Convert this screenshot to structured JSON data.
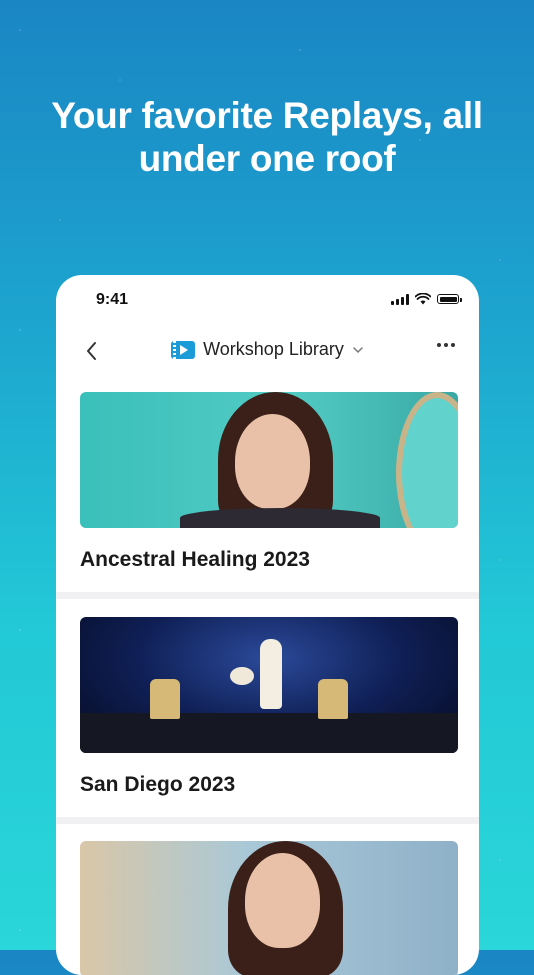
{
  "headline": "Your favorite Replays, all under one roof",
  "status_bar": {
    "time": "9:41"
  },
  "nav": {
    "title": "Workshop Library",
    "title_icon": "film-icon",
    "back_icon": "chevron-left-icon",
    "dropdown_icon": "chevron-down-icon",
    "more_icon": "more-horizontal-icon"
  },
  "items": [
    {
      "title": "Ancestral Healing 2023"
    },
    {
      "title": "San Diego 2023"
    },
    {
      "title": ""
    }
  ],
  "colors": {
    "accent": "#1b9cd8",
    "background_top": "#1a86c4",
    "background_bottom": "#2ad6d9"
  }
}
